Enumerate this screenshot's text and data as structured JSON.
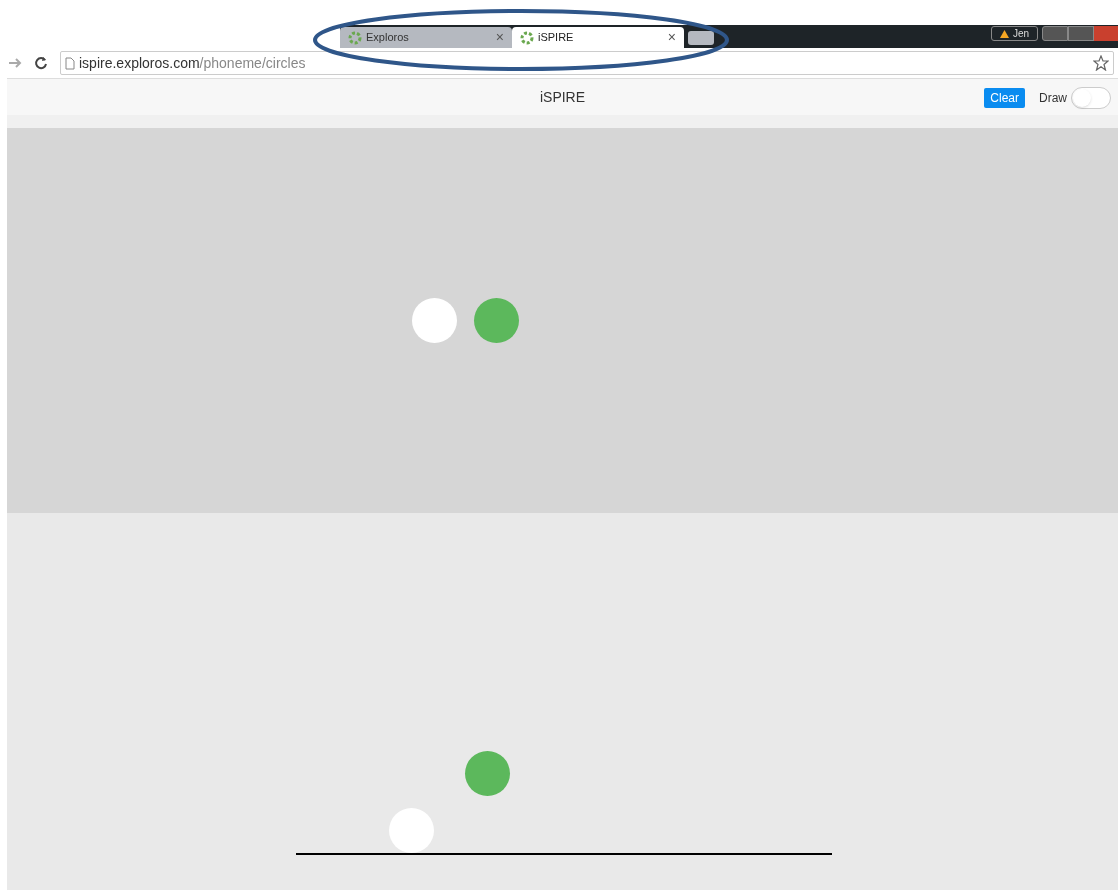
{
  "browser": {
    "tabs": [
      {
        "title": "Exploros",
        "selected": false,
        "close": "×"
      },
      {
        "title": "iSPIRE",
        "selected": true,
        "close": "×"
      }
    ],
    "user": "Jen",
    "url": {
      "host": "ispire.exploros.com",
      "path": "/phoneme/circles"
    }
  },
  "app_bar": {
    "title": "iSPIRE",
    "clear_button": "Clear",
    "draw_label": "Draw",
    "draw_toggle": {
      "on": false
    }
  },
  "top_area": {
    "circles": [
      {
        "color": "#ffffff"
      },
      {
        "color": "#5cb85c"
      }
    ]
  },
  "bottom_area": {
    "circles": [
      {
        "color": "#5cb85c"
      },
      {
        "color": "#ffffff"
      }
    ]
  }
}
